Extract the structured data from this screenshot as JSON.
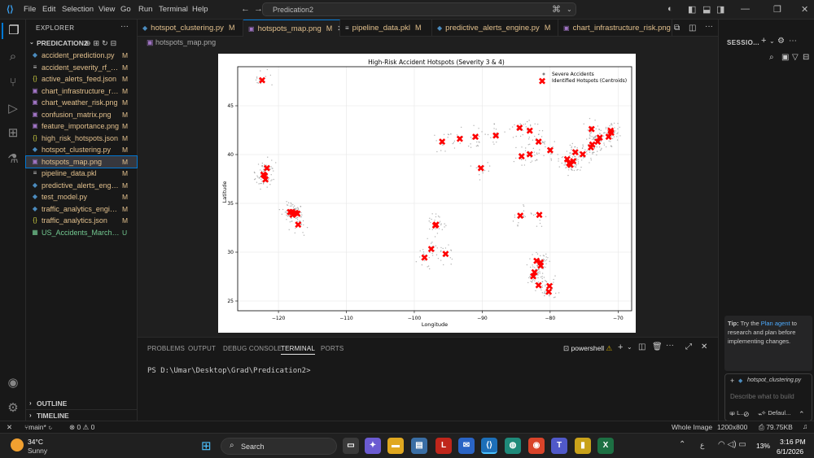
{
  "titlebar": {
    "menus": [
      "File",
      "Edit",
      "Selection",
      "View",
      "Go",
      "Run",
      "Terminal",
      "Help"
    ],
    "search_text": "Predication2"
  },
  "explorer": {
    "header": "EXPLORER",
    "folder": "PREDICATION2",
    "files": [
      {
        "name": "accident_prediction.py",
        "status": "M",
        "icon": "python-icon"
      },
      {
        "name": "accident_severity_rf_mo...",
        "status": "M",
        "icon": "file-icon"
      },
      {
        "name": "active_alerts_feed.json",
        "status": "M",
        "icon": "json-icon"
      },
      {
        "name": "chart_infrastructure_risk...",
        "status": "M",
        "icon": "image-icon"
      },
      {
        "name": "chart_weather_risk.png",
        "status": "M",
        "icon": "image-icon"
      },
      {
        "name": "confusion_matrix.png",
        "status": "M",
        "icon": "image-icon"
      },
      {
        "name": "feature_importance.png",
        "status": "M",
        "icon": "image-icon"
      },
      {
        "name": "high_risk_hotspots.json",
        "status": "M",
        "icon": "json-icon"
      },
      {
        "name": "hotspot_clustering.py",
        "status": "M",
        "icon": "python-icon"
      },
      {
        "name": "hotspots_map.png",
        "status": "M",
        "icon": "image-icon"
      },
      {
        "name": "pipeline_data.pkl",
        "status": "M",
        "icon": "file-icon"
      },
      {
        "name": "predictive_alerts_engine...",
        "status": "M",
        "icon": "python-icon"
      },
      {
        "name": "test_model.py",
        "status": "M",
        "icon": "python-icon"
      },
      {
        "name": "traffic_analytics_engine...",
        "status": "M",
        "icon": "python-icon"
      },
      {
        "name": "traffic_analytics.json",
        "status": "M",
        "icon": "json-icon"
      },
      {
        "name": "US_Accidents_March23....",
        "status": "U",
        "icon": "csv-icon"
      }
    ],
    "outline": "OUTLINE",
    "timeline": "TIMELINE"
  },
  "tabs": [
    {
      "label": "hotspot_clustering.py",
      "status": "M"
    },
    {
      "label": "hotspots_map.png",
      "status": "M"
    },
    {
      "label": "pipeline_data.pkl",
      "status": "M"
    },
    {
      "label": "predictive_alerts_engine.py",
      "status": "M"
    },
    {
      "label": "chart_infrastructure_risk.png",
      "status": "M"
    }
  ],
  "breadcrumb": "hotspots_map.png",
  "chart_data": {
    "type": "scatter",
    "title": "High-Risk Accident Hotspots (Severity 3 & 4)",
    "xlabel": "Longitude",
    "ylabel": "Latitude",
    "xlim": [
      -126,
      -68
    ],
    "ylim": [
      24,
      49
    ],
    "xticks": [
      -120,
      -110,
      -100,
      -90,
      -80,
      -70
    ],
    "yticks": [
      25,
      30,
      35,
      40,
      45
    ],
    "grid": true,
    "legend_position": "top-right",
    "legend": [
      "Severe Accidents",
      "Identified Hotspots (Centroids)"
    ],
    "colors": {
      "accidents": "#808080",
      "hotspots": "#ff0000"
    },
    "hotspots": [
      {
        "x": -122.4,
        "y": 47.6
      },
      {
        "x": -121.7,
        "y": 38.6
      },
      {
        "x": -122.2,
        "y": 37.9
      },
      {
        "x": -121.9,
        "y": 37.4
      },
      {
        "x": -122.0,
        "y": 37.8
      },
      {
        "x": -118.3,
        "y": 34.1
      },
      {
        "x": -117.9,
        "y": 33.8
      },
      {
        "x": -117.5,
        "y": 34.0
      },
      {
        "x": -117.2,
        "y": 33.9
      },
      {
        "x": -117.1,
        "y": 32.8
      },
      {
        "x": -118.0,
        "y": 34.1
      },
      {
        "x": -96.8,
        "y": 32.8
      },
      {
        "x": -96.9,
        "y": 32.7
      },
      {
        "x": -97.5,
        "y": 30.3
      },
      {
        "x": -98.5,
        "y": 29.4
      },
      {
        "x": -95.4,
        "y": 29.8
      },
      {
        "x": -95.9,
        "y": 41.3
      },
      {
        "x": -93.3,
        "y": 41.6
      },
      {
        "x": -91.0,
        "y": 41.8
      },
      {
        "x": -90.2,
        "y": 38.6
      },
      {
        "x": -88.0,
        "y": 41.9
      },
      {
        "x": -84.5,
        "y": 42.7
      },
      {
        "x": -83.0,
        "y": 42.4
      },
      {
        "x": -81.7,
        "y": 41.3
      },
      {
        "x": -84.2,
        "y": 39.8
      },
      {
        "x": -83.0,
        "y": 40.0
      },
      {
        "x": -80.0,
        "y": 40.4
      },
      {
        "x": -84.4,
        "y": 33.7
      },
      {
        "x": -81.6,
        "y": 33.8
      },
      {
        "x": -82.0,
        "y": 29.1
      },
      {
        "x": -81.4,
        "y": 28.9
      },
      {
        "x": -82.3,
        "y": 27.9
      },
      {
        "x": -82.5,
        "y": 27.5
      },
      {
        "x": -81.7,
        "y": 26.6
      },
      {
        "x": -80.1,
        "y": 26.5
      },
      {
        "x": -80.2,
        "y": 25.9
      },
      {
        "x": -81.4,
        "y": 28.6
      },
      {
        "x": -77.5,
        "y": 39.5
      },
      {
        "x": -77.0,
        "y": 38.9
      },
      {
        "x": -76.6,
        "y": 39.3
      },
      {
        "x": -77.2,
        "y": 39.1
      },
      {
        "x": -76.3,
        "y": 40.2
      },
      {
        "x": -75.2,
        "y": 40.0
      },
      {
        "x": -74.0,
        "y": 40.7
      },
      {
        "x": -73.8,
        "y": 41.0
      },
      {
        "x": -73.0,
        "y": 41.3
      },
      {
        "x": -72.7,
        "y": 41.7
      },
      {
        "x": -71.4,
        "y": 41.8
      },
      {
        "x": -71.1,
        "y": 42.4
      },
      {
        "x": -71.0,
        "y": 42.2
      },
      {
        "x": -73.9,
        "y": 42.6
      }
    ]
  },
  "panel": {
    "tabs": [
      "PROBLEMS",
      "OUTPUT",
      "DEBUG CONSOLE",
      "TERMINAL",
      "PORTS"
    ],
    "active_tab": "TERMINAL",
    "shell": "powershell",
    "prompt": "PS D:\\Umar\\Desktop\\Grad\\Predication2>"
  },
  "chat": {
    "title": "SESSIO...",
    "tip_label": "Tip:",
    "tip_pre": "Try the",
    "tip_link": "Plan agent",
    "tip_post": "to research and plan before implementing changes.",
    "context_file": "hotspot_clustering.py",
    "input_placeholder": "Describe what to build",
    "mode_label": "L...",
    "model_label": "Defaul..."
  },
  "statusbar": {
    "branch": "main*",
    "errors": "0",
    "warnings": "0",
    "view": "Whole Image",
    "dimensions": "1200x800",
    "filesize": "79.75KB"
  },
  "taskbar": {
    "weather_temp": "34°C",
    "weather_desc": "Sunny",
    "search_label": "Search",
    "battery": "13%",
    "time": "3:16 PM",
    "date": "6/1/2026"
  }
}
